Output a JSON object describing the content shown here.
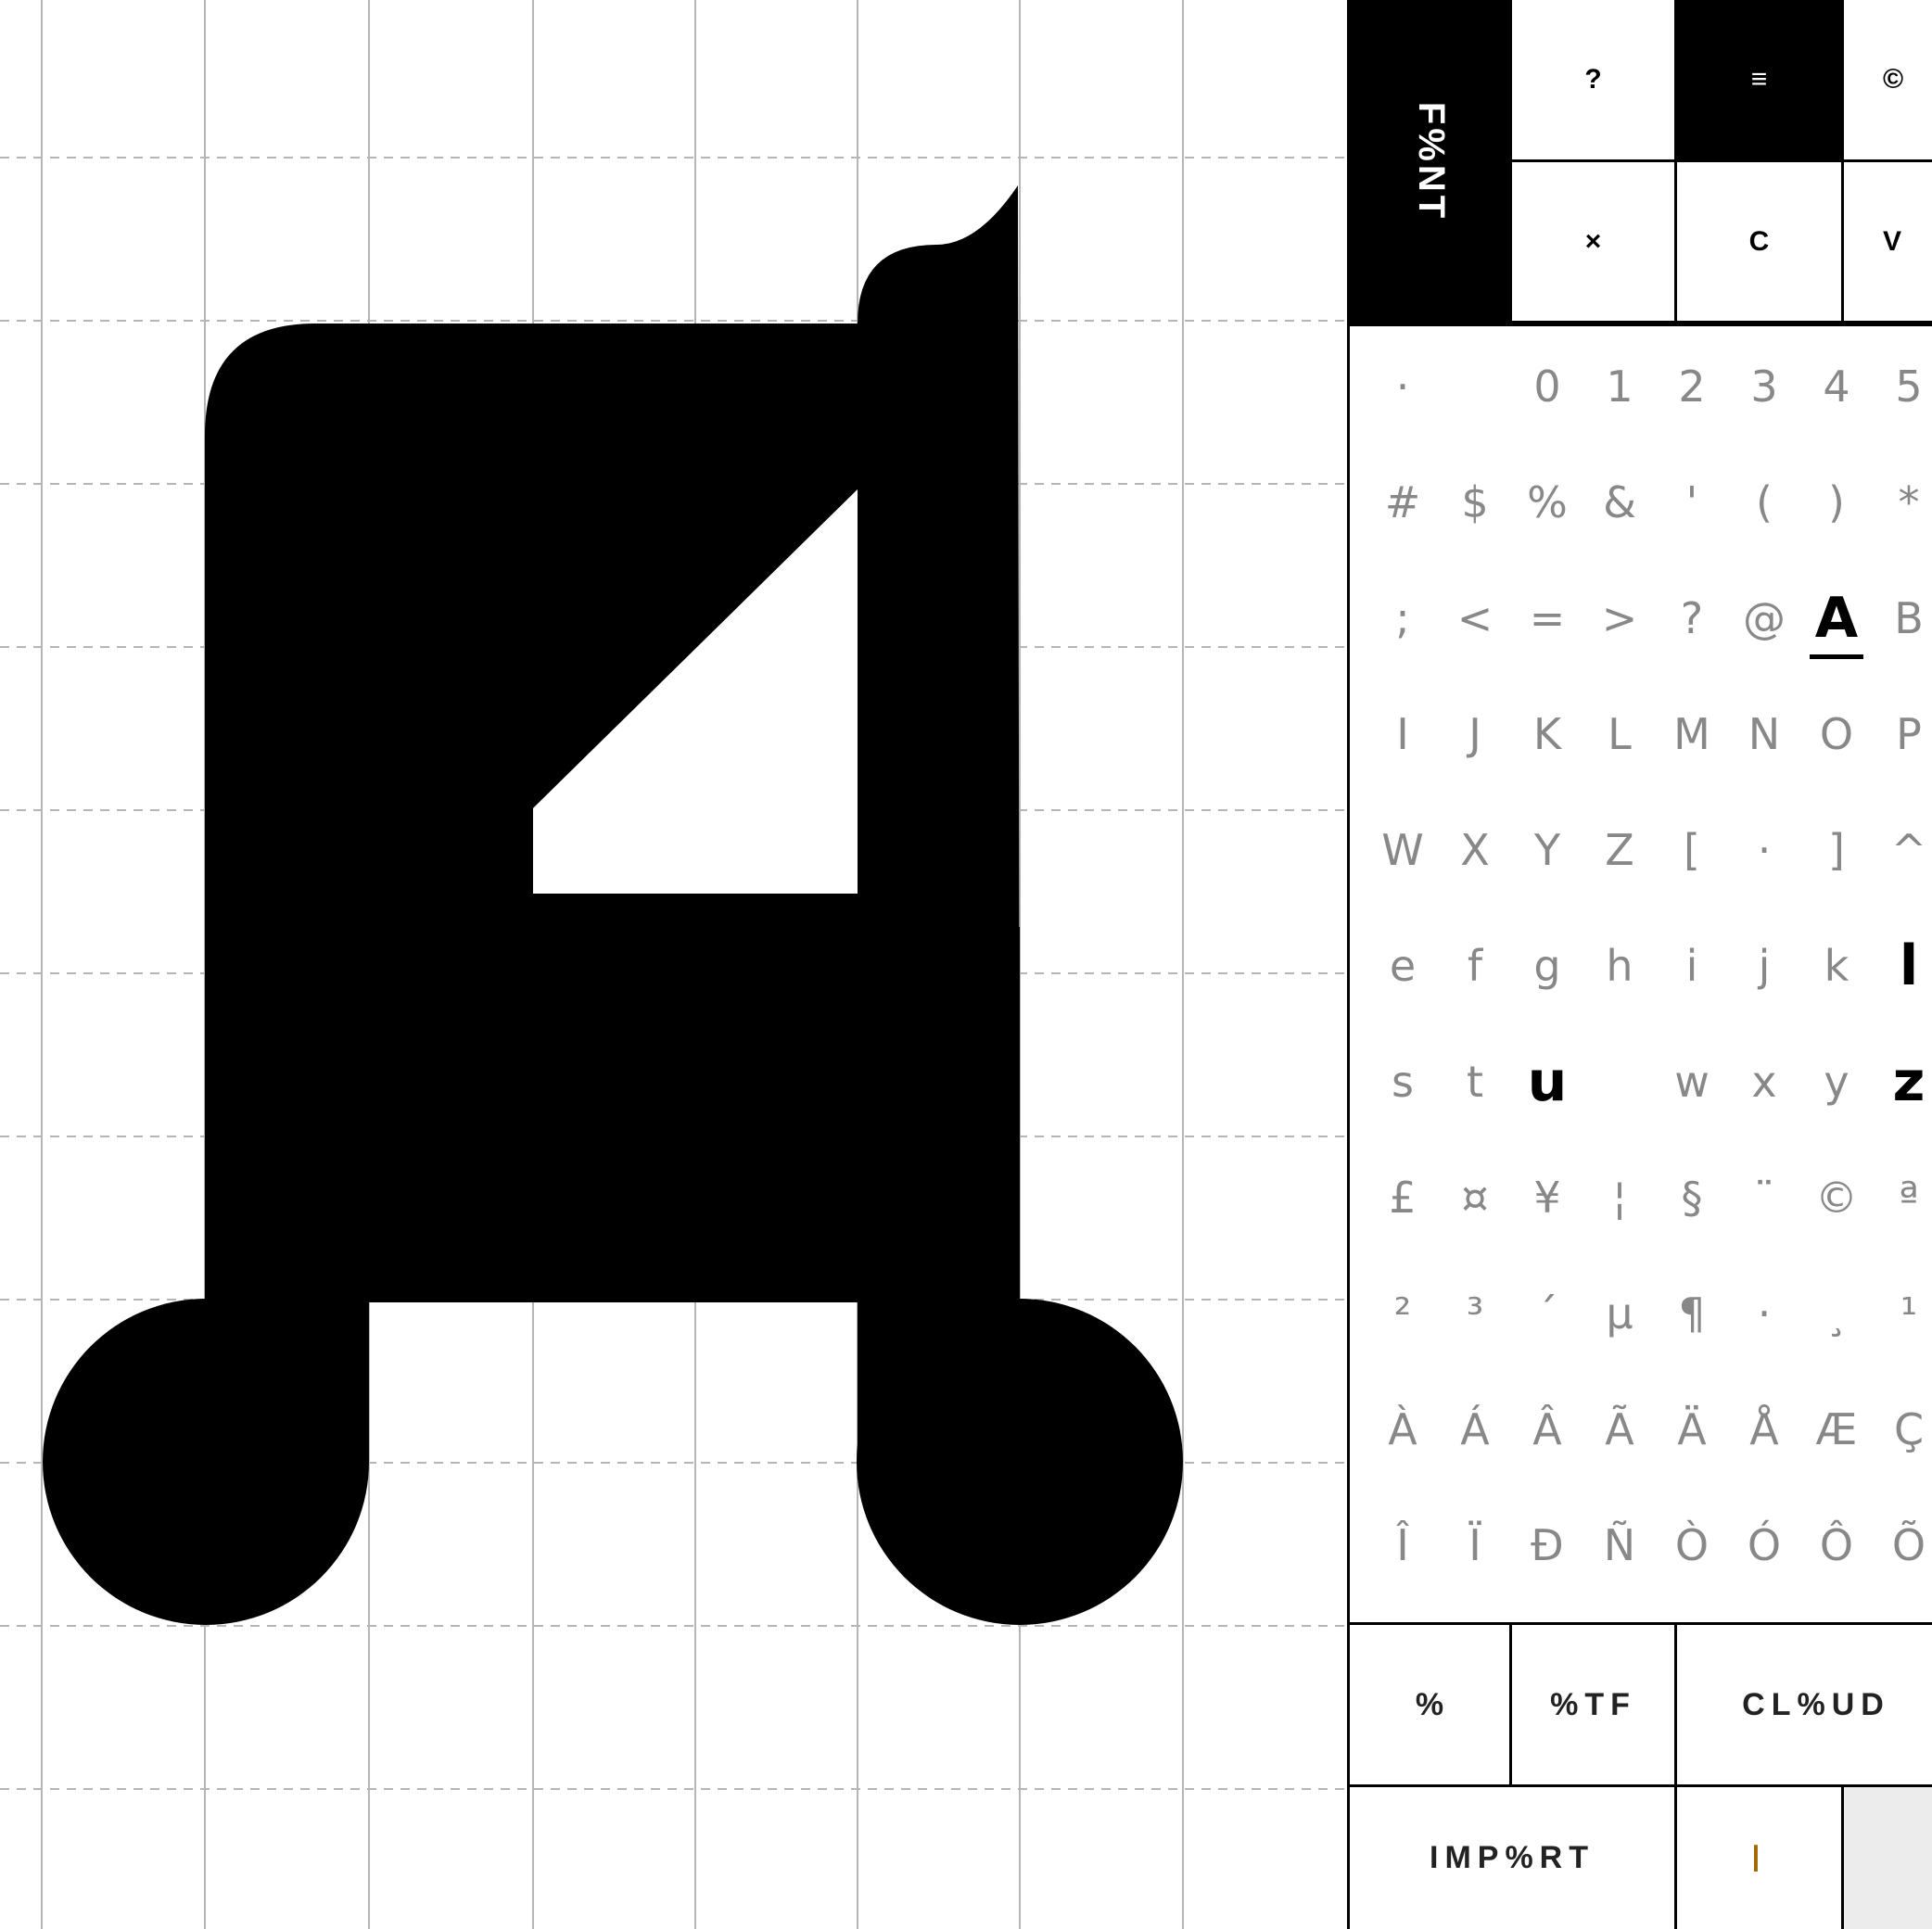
{
  "app": {
    "logo": "F%NT"
  },
  "toolbar": {
    "help_label": "?",
    "menu_label": "≡",
    "copyright_label": "©",
    "close_label": "×",
    "copy_label": "C",
    "paste_label": "V"
  },
  "editor": {
    "glyph_name": "A",
    "glyph_color": "#000000",
    "grid_color": "#b5b5b5"
  },
  "glyphs": {
    "rows": [
      [
        "·",
        "",
        "0",
        "1",
        "2",
        "3",
        "4",
        "5"
      ],
      [
        "#",
        "$",
        "%",
        "&",
        "'",
        "(",
        ")",
        "*"
      ],
      [
        ";",
        "<",
        "=",
        ">",
        "?",
        "@",
        "A",
        "B"
      ],
      [
        "I",
        "J",
        "K",
        "L",
        "M",
        "N",
        "O",
        "P"
      ],
      [
        "W",
        "X",
        "Y",
        "Z",
        "[",
        "·",
        "]",
        "^"
      ],
      [
        "e",
        "f",
        "g",
        "h",
        "i",
        "j",
        "k",
        "l"
      ],
      [
        "s",
        "t",
        "u",
        "",
        "w",
        "x",
        "y",
        "z"
      ],
      [
        "£",
        "¤",
        "¥",
        "¦",
        "§",
        "¨",
        "©",
        "ª"
      ],
      [
        "²",
        "³",
        "´",
        "µ",
        "¶",
        "·",
        "¸",
        "¹"
      ],
      [
        "À",
        "Á",
        "Â",
        "Ã",
        "Ä",
        "Å",
        "Æ",
        "Ç"
      ],
      [
        "Î",
        "Ï",
        "Ð",
        "Ñ",
        "Ò",
        "Ó",
        "Ô",
        "Õ"
      ]
    ],
    "selected": "A",
    "edited": [
      "A",
      "l",
      "u",
      "z"
    ]
  },
  "actions": {
    "o_label": "%",
    "otf_label": "%TF",
    "cloud_label": "CL%UD",
    "import_label": "IMP%RT",
    "text_input_value": "",
    "cursor_char": "I"
  }
}
